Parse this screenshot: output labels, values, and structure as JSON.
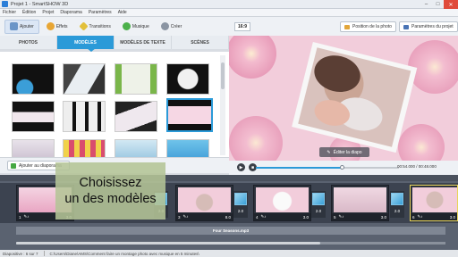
{
  "window": {
    "title": "Projet 1 - SmartSHOW 3D"
  },
  "menu": [
    "Fichier",
    "Édition",
    "Projet",
    "Diaporama",
    "Paramètres",
    "Aide"
  ],
  "toolbar": {
    "items": [
      {
        "label": "Ajouter",
        "icon": "add-photos-icon",
        "color": "#6a95c8"
      },
      {
        "label": "Effets",
        "icon": "effects-icon",
        "color": "#e8a634"
      },
      {
        "label": "Transitions",
        "icon": "transitions-icon",
        "color": "#e2c03a"
      },
      {
        "label": "Musique",
        "icon": "music-icon",
        "color": "#4bb04a"
      },
      {
        "label": "Créer",
        "icon": "create-icon",
        "color": "#8b95a3"
      }
    ]
  },
  "tabs": [
    "PHOTOS",
    "MODÈLES",
    "MODÈLES DE TEXTE",
    "SCÈNES"
  ],
  "gallery": {
    "add_button": "Ajouter au diaporama"
  },
  "overlay": {
    "line1": "Choisissez",
    "line2": "un des modèles"
  },
  "preview": {
    "ratio": "16:9",
    "position_button": "Position de la photo",
    "params_button": "Paramètres du projet",
    "edit_button": "Éditer la diapo",
    "time_current": "00:54.000",
    "time_total": "00:48.000",
    "progress": 0.6
  },
  "timeline": {
    "slides": [
      {
        "num": "1",
        "dur": "3.0"
      },
      {
        "num": "3",
        "dur": "8.0"
      },
      {
        "num": "4",
        "dur": "3.0"
      },
      {
        "num": "5",
        "dur": "3.0"
      },
      {
        "num": "6",
        "dur": "3.0"
      }
    ],
    "transitions": [
      "2.0",
      "2.0",
      "2.0",
      "2.0"
    ],
    "audio": "Four Seasons.mp3"
  },
  "status": {
    "slide": "Diapositive : 6 sur 7",
    "path": "C:\\Users\\Diane\\AMS\\Comment faire un montage photo avec musique en 5 minutes\\"
  }
}
